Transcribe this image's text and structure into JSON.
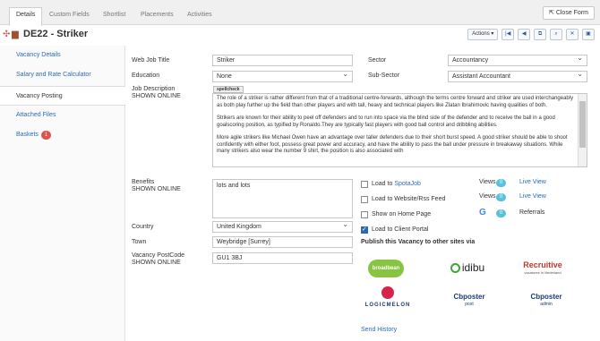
{
  "tabs": [
    {
      "label": "Details"
    },
    {
      "label": "Custom Fields"
    },
    {
      "label": "Shortlist"
    },
    {
      "label": "Placements"
    },
    {
      "label": "Activities"
    }
  ],
  "close_form": "Close Form",
  "page_title": "DE22 - Striker",
  "toolbar": {
    "actions_label": "Actions ▾"
  },
  "sidebar": {
    "items": [
      {
        "label": "Vacancy Details"
      },
      {
        "label": "Salary and Rate Calculator"
      },
      {
        "label": "Vacancy Posting"
      },
      {
        "label": "Attached Files"
      },
      {
        "label": "Baskets",
        "badge": "1"
      }
    ]
  },
  "form": {
    "web_job_title_label": "Web Job Title",
    "web_job_title": "Striker",
    "sector_label": "Sector",
    "sector": "Accountancy",
    "education_label": "Education",
    "education": "None",
    "sub_sector_label": "Sub-Sector",
    "sub_sector": "Assistant Accountant",
    "job_desc_label": "Job Description",
    "shown_online": "SHOWN ONLINE",
    "spellcheck": "spellcheck",
    "desc_p1": "The role of a striker is rather different from that of a traditional centre-forwards, although the terms centre forward and striker are used interchangeably as both play further up the field than other players and with tall, heavy and technical players like Zlatan Ibrahimovic having qualities of both.",
    "desc_p2": "Strikers are known for their ability to peel off defenders and to run into space via the blind side of the defender and to receive the ball in a good goalscoring position, as typified by Ronaldo.They are typically fast players with good ball control and dribbling abilities.",
    "desc_p3": "More agile strikers like Michael Owen have an advantage over taller defenders due to their short burst speed. A good striker should be able to shoot confidently with either foot, possess great power and accuracy, and have the ability to pass the ball under pressure in breakaway situations. While many strikers also wear the number 9 shirt, the position is also associated with",
    "benefits_label": "Benefits",
    "benefits": "lots and lots",
    "country_label": "Country",
    "country": "United Kingdom",
    "town_label": "Town",
    "town": "Weybridge [Surrey]",
    "postcode_label": "Vacancy PostCode",
    "postcode": "GU1 3BJ"
  },
  "posting": {
    "load_to": "Load to ",
    "spotajob": "SpotaJob",
    "website_rss": "Load to Website/Rss Feed",
    "home_page": "Show on Home Page",
    "client_portal": "Load to Client Portal",
    "views_label": "Views",
    "views1": "0",
    "views2": "0",
    "referrals_count": "0",
    "live_view": "Live View",
    "referrals_label": "Referrals",
    "google_glyph": "G",
    "publish_title": "Publish this Vacancy to other sites via",
    "send_history": "Send History"
  },
  "logos": {
    "broadbean": "broadbean",
    "idibu": "idibu",
    "recruitive": "Recruitive",
    "recruitive_sub": "vacatures in Nederland",
    "logicmelon": "LOGICMELON",
    "broadcaster": "Cbposter",
    "broadcaster_post": "post",
    "broadcaster_admin": "admin"
  },
  "colors": {
    "accent": "#2a6ab8",
    "badge": "#d9534f",
    "info": "#5bc0de"
  }
}
